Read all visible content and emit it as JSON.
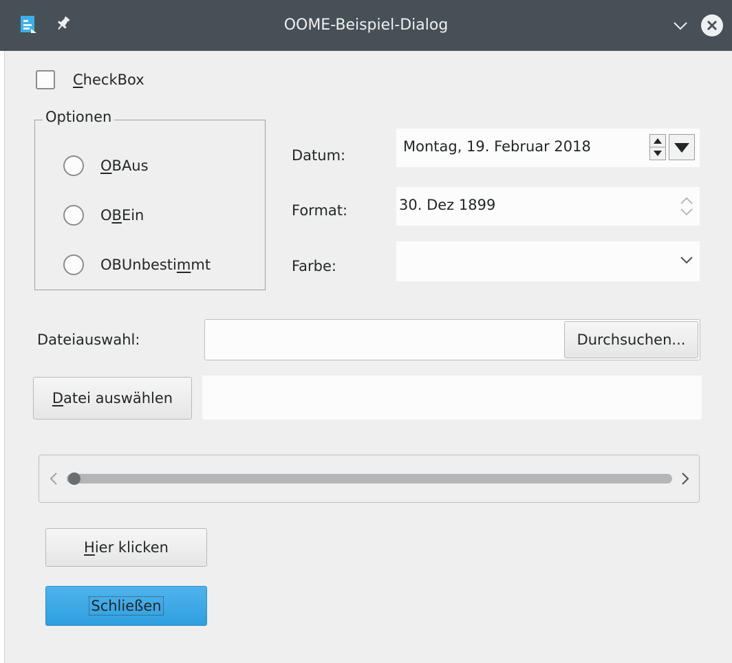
{
  "window": {
    "title": "OOME-Beispiel-Dialog",
    "icons": {
      "app": "document-icon",
      "pin": "pin-icon",
      "menu": "chevron-down-icon",
      "close": "close-icon"
    },
    "titlebar_color": "#475057"
  },
  "checkbox": {
    "mnemonic": "C",
    "rest": "heckBox",
    "checked": false
  },
  "options_group": {
    "title": "Optionen",
    "radios": [
      {
        "before": "",
        "mnemonic": "O",
        "after": "BAus",
        "selected": false
      },
      {
        "before": "O",
        "mnemonic": "B",
        "after": "Ein",
        "selected": false
      },
      {
        "before": "OBUnbesti",
        "mnemonic": "m",
        "after": "mt",
        "selected": false
      }
    ]
  },
  "fields": {
    "date_label": "Datum:",
    "date_value": "Montag, 19. Februar 2018",
    "format_label": "Format:",
    "format_value": "30. Dez 1899",
    "color_label": "Farbe:",
    "color_value": ""
  },
  "file": {
    "label": "Dateiauswahl:",
    "path": "",
    "browse_label": "Durchsuchen..."
  },
  "select_file_button": {
    "mnemonic": "D",
    "rest": "atei auswählen"
  },
  "selected_file_text": "",
  "scrollbar": {
    "value_fraction": 0.0
  },
  "here_button": {
    "mnemonic": "H",
    "rest": "ier klicken"
  },
  "close_button": {
    "label": "Schließen",
    "accent": "#3daee9"
  }
}
